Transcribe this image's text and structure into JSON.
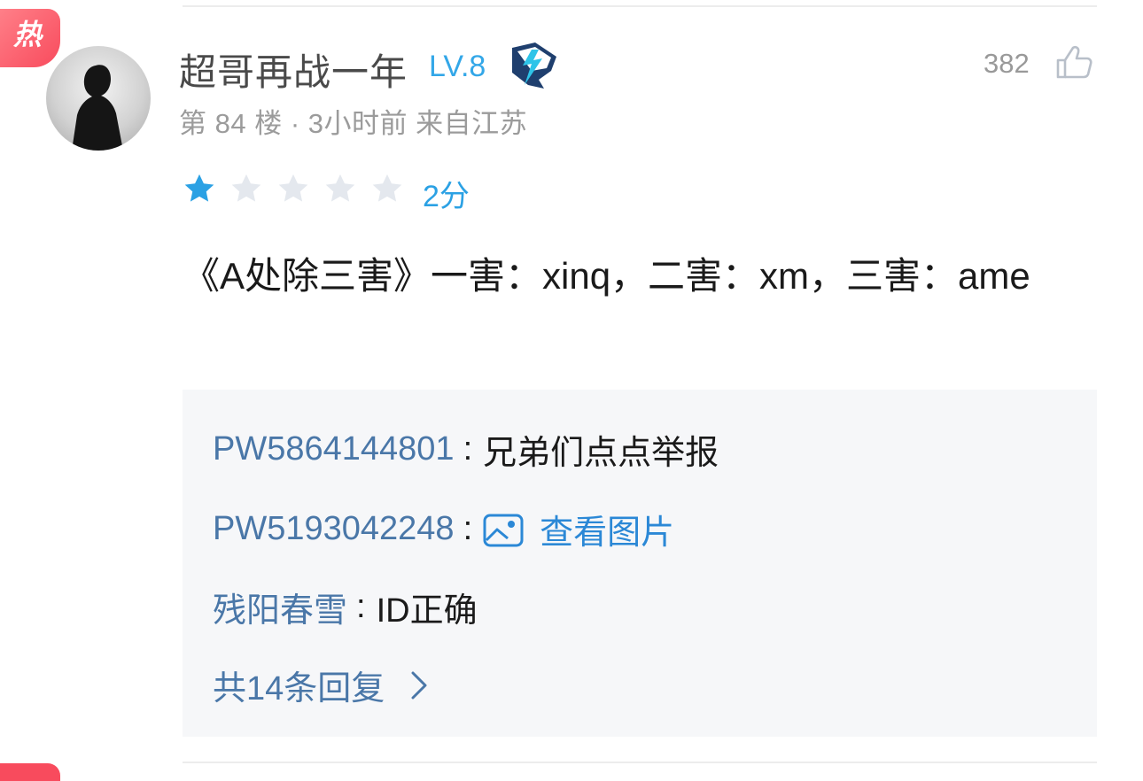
{
  "badge": {
    "label": "热"
  },
  "user": {
    "name": "超哥再战一年",
    "level": "LV.8"
  },
  "meta": {
    "text": "第 84 楼 · 3小时前  来自江苏"
  },
  "likes": {
    "count": "382"
  },
  "rating": {
    "value": 1,
    "max": 5,
    "label": "2分",
    "filled_color": "#2ba1e4",
    "empty_color": "#e4e8ee"
  },
  "comment": {
    "text": "《A处除三害》一害：xinq，二害：xm，三害：ame"
  },
  "replies": [
    {
      "author": "PW5864144801",
      "separator": ":",
      "text": "兄弟们点点举报",
      "type": "text"
    },
    {
      "author": "PW5193042248",
      "separator": ":",
      "text": "查看图片",
      "type": "image"
    },
    {
      "author": "残阳春雪",
      "separator": ":",
      "text": "ID正确",
      "type": "text"
    }
  ],
  "more_replies": {
    "label": "共14条回复"
  },
  "icons": {
    "like": "thumbs-up-icon",
    "image": "image-icon",
    "chevron": "chevron-right-icon",
    "medal": "medal-icon"
  },
  "colors": {
    "hot_badge": "#f84b5d",
    "level": "#33a7e8",
    "reply_author": "#4a77a8",
    "link": "#2b88d6"
  }
}
